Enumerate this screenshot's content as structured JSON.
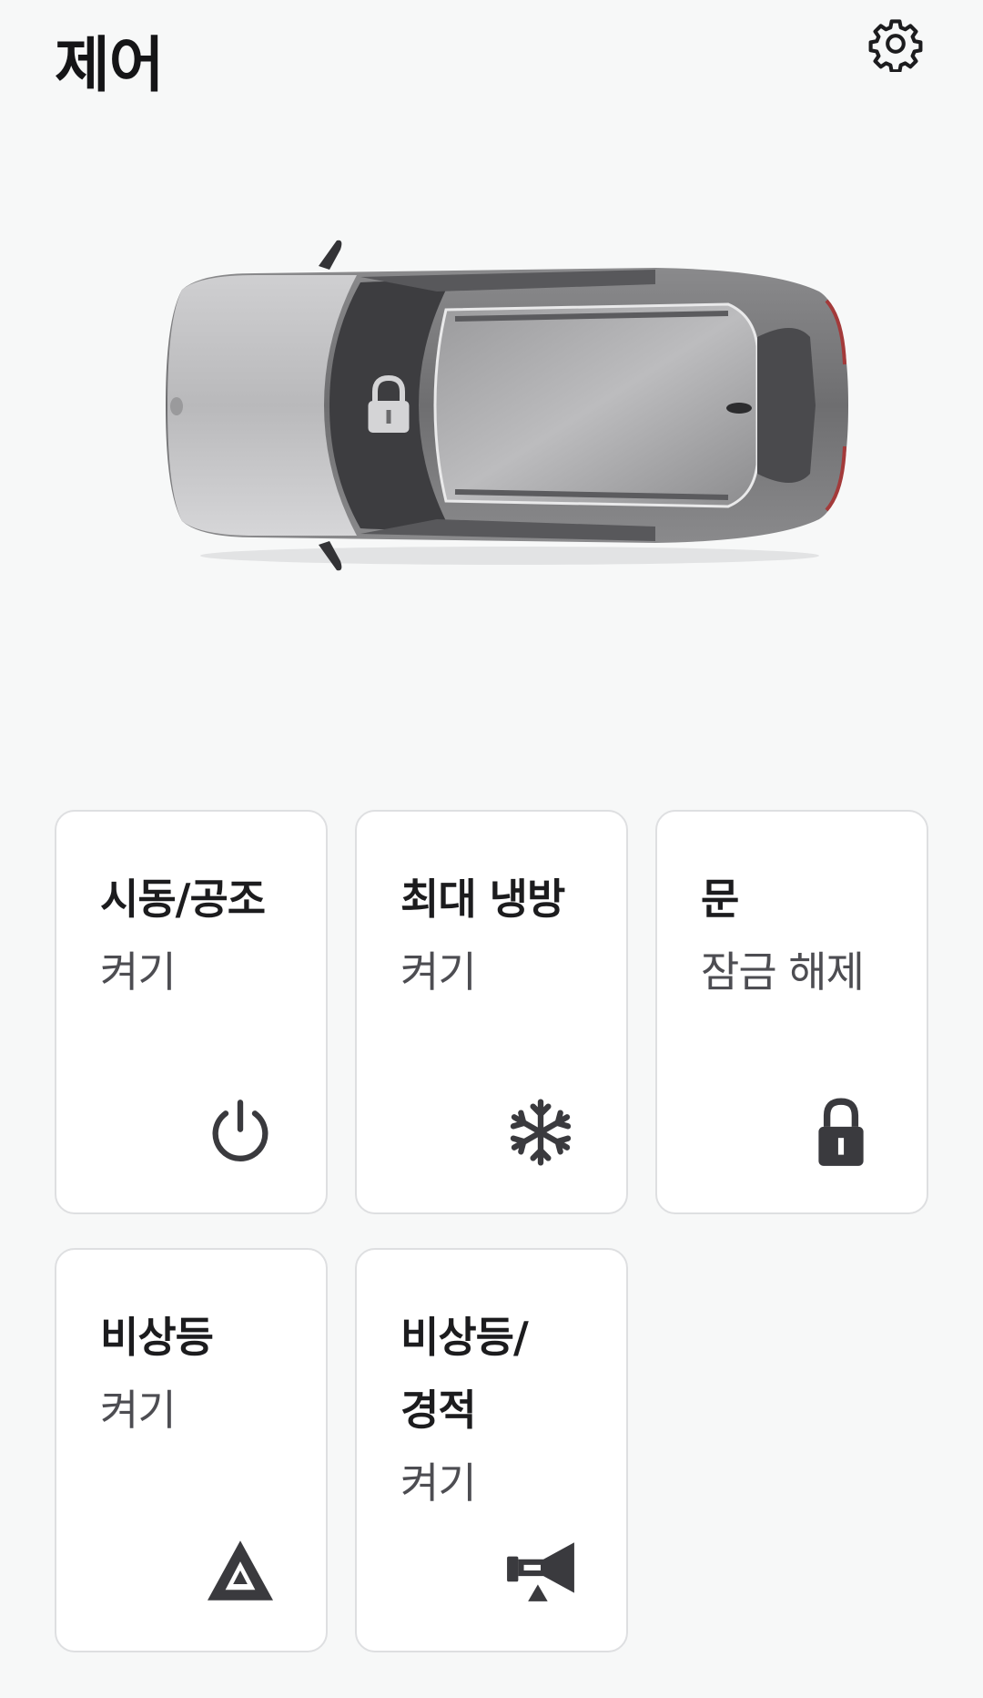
{
  "header": {
    "title": "제어",
    "settings_icon": "gear-icon"
  },
  "vehicle": {
    "lock_icon": "lock-icon",
    "body_color": "#9b9b9d"
  },
  "controls": [
    {
      "title": "시동/공조",
      "status": "켜기",
      "icon": "power-icon"
    },
    {
      "title": "최대 냉방",
      "status": "켜기",
      "icon": "snowflake-icon"
    },
    {
      "title": "문",
      "status": "잠금 해제",
      "icon": "lock-icon"
    },
    {
      "title": "비상등",
      "status": "켜기",
      "icon": "hazard-icon"
    },
    {
      "title_line1": "비상등/",
      "title_line2": "경적",
      "status": "켜기",
      "icon": "horn-icon"
    }
  ],
  "colors": {
    "background": "#f7f8f8",
    "tile_border": "#dedfe1",
    "icon": "#3a3a3e"
  }
}
